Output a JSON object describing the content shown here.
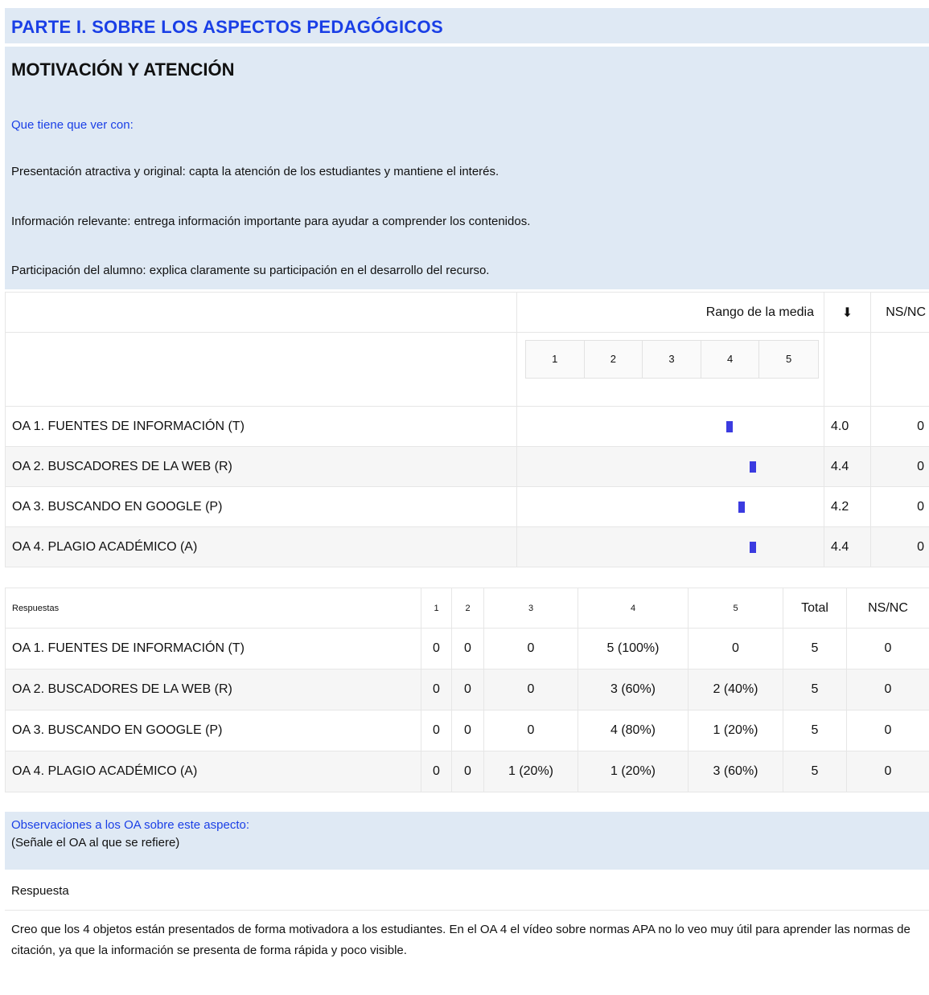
{
  "part_title": "PARTE I. SOBRE LOS ASPECTOS PEDAGÓGICOS",
  "section": {
    "title": "MOTIVACIÓN Y ATENCIÓN",
    "relates_label": "Que tiene que ver con:",
    "criteria": [
      "Presentación atractiva y original: capta la atención de los estudiantes y mantiene el interés.",
      "Información relevante: entrega información importante para ayudar a comprender los contenidos.",
      "Participación del alumno: explica claramente su participación en el desarrollo del recurso."
    ]
  },
  "mean_table": {
    "range_header": "Rango de la media",
    "sort_header": "⬇",
    "nsnc_header": "NS/NC",
    "scale": [
      "1",
      "2",
      "3",
      "4",
      "5"
    ],
    "rows": [
      {
        "label": "OA 1. FUENTES DE INFORMACIÓN (T)",
        "mean": 4.0,
        "mean_text": "4.0",
        "nsnc": "0"
      },
      {
        "label": "OA 2. BUSCADORES DE LA WEB (R)",
        "mean": 4.4,
        "mean_text": "4.4",
        "nsnc": "0"
      },
      {
        "label": "OA 3. BUSCANDO EN GOOGLE (P)",
        "mean": 4.2,
        "mean_text": "4.2",
        "nsnc": "0"
      },
      {
        "label": "OA 4. PLAGIO ACADÉMICO (A)",
        "mean": 4.4,
        "mean_text": "4.4",
        "nsnc": "0"
      }
    ],
    "bar_color": "#3b3be0"
  },
  "answers_table": {
    "header": [
      "Respuestas",
      "1",
      "2",
      "3",
      "4",
      "5",
      "Total",
      "NS/NC"
    ],
    "rows": [
      [
        "OA 1. FUENTES DE INFORMACIÓN (T)",
        "0",
        "0",
        "0",
        "5 (100%)",
        "0",
        "5",
        "0"
      ],
      [
        "OA 2. BUSCADORES DE LA WEB (R)",
        "0",
        "0",
        "0",
        "3 (60%)",
        "2 (40%)",
        "5",
        "0"
      ],
      [
        "OA 3. BUSCANDO EN GOOGLE (P)",
        "0",
        "0",
        "0",
        "4 (80%)",
        "1 (20%)",
        "5",
        "0"
      ],
      [
        "OA 4. PLAGIO ACADÉMICO (A)",
        "0",
        "0",
        "1 (20%)",
        "1 (20%)",
        "3 (60%)",
        "5",
        "0"
      ]
    ]
  },
  "observations": {
    "title": "Observaciones a los OA sobre este aspecto:",
    "subtitle": "(Señale el OA al que se refiere)",
    "response_label": "Respuesta",
    "response_text": "Creo que los 4 objetos están presentados de forma motivadora a los estudiantes. En el OA 4 el vídeo sobre normas APA no lo veo muy útil para aprender las normas de citación, ya que la información se presenta de forma rápida y poco visible."
  },
  "colors": {
    "header_bg": "#dfe9f4",
    "accent_blue": "#1a3fe6"
  }
}
